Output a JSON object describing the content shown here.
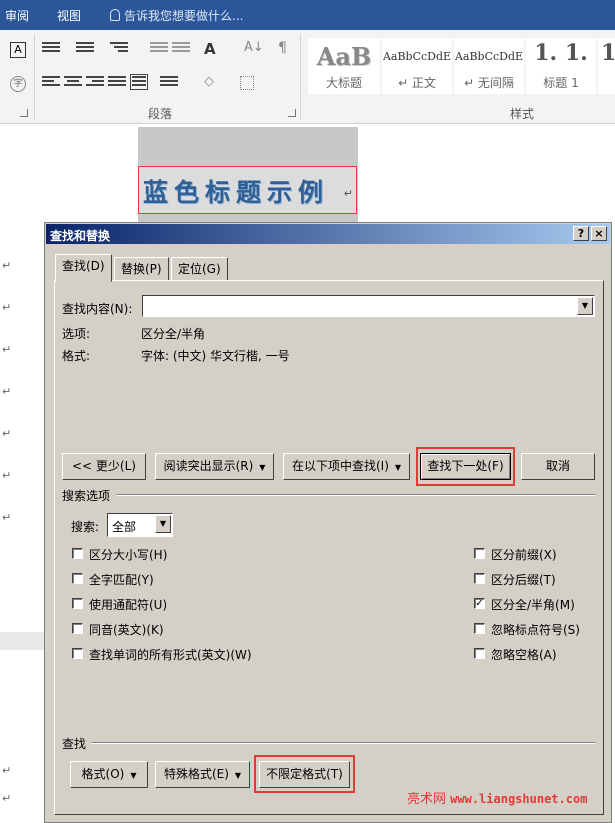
{
  "ribbon": {
    "tabs": [
      "审阅",
      "视图"
    ],
    "tell_me": "告诉我您想要做什么...",
    "paragraph_group": "段落",
    "styles_group": "样式",
    "styles": [
      {
        "preview": "AaB",
        "name": "大标题"
      },
      {
        "preview": "AaBbCcDdE",
        "name": "↵ 正文"
      },
      {
        "preview": "AaBbCcDdE",
        "name": "↵ 无间隔"
      },
      {
        "preview": "1. 1.",
        "name": "标题 1"
      },
      {
        "preview": "1",
        "name": ""
      }
    ]
  },
  "document": {
    "sample_title": "蓝色标题示例",
    "para_mark": "↵"
  },
  "dialog": {
    "title": "查找和替换",
    "help_btn": "?",
    "close_btn": "×",
    "tabs": {
      "find": "查找(D)",
      "replace": "替换(P)",
      "goto": "定位(G)"
    },
    "find_label": "查找内容(N):",
    "find_value": "",
    "options_label": "选项:",
    "options_value": "区分全/半角",
    "format_label": "格式:",
    "format_value": "字体: (中文) 华文行楷, 一号",
    "buttons": {
      "less": "<< 更少(L)",
      "reading_highlight": "阅读突出显示(R)",
      "find_in": "在以下项中查找(I)",
      "find_next": "查找下一处(F)",
      "cancel": "取消"
    },
    "search_options_title": "搜索选项",
    "search_label": "搜索:",
    "search_value": "全部",
    "left_options": [
      {
        "label": "区分大小写(H)",
        "checked": false
      },
      {
        "label": "全字匹配(Y)",
        "checked": false
      },
      {
        "label": "使用通配符(U)",
        "checked": false
      },
      {
        "label": "同音(英文)(K)",
        "checked": false
      },
      {
        "label": "查找单词的所有形式(英文)(W)",
        "checked": false
      }
    ],
    "right_options": [
      {
        "label": "区分前缀(X)",
        "checked": false
      },
      {
        "label": "区分后缀(T)",
        "checked": false
      },
      {
        "label": "区分全/半角(M)",
        "checked": true
      },
      {
        "label": "忽略标点符号(S)",
        "checked": false
      },
      {
        "label": "忽略空格(A)",
        "checked": false
      }
    ],
    "find_section_title": "查找",
    "bottom_buttons": {
      "format": "格式(O)",
      "special": "特殊格式(E)",
      "no_format": "不限定格式(T)"
    }
  },
  "watermark": {
    "site": "亮术网",
    "url": "www.liangshunet.com"
  }
}
